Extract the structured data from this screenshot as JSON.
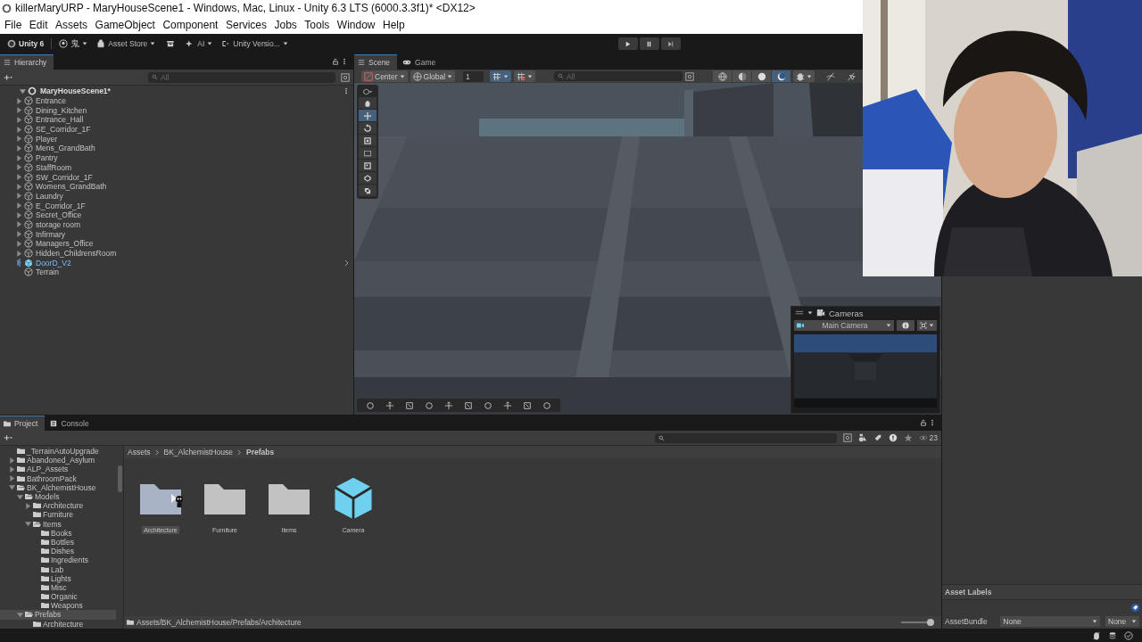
{
  "window": {
    "title": "killerMaryURP - MaryHouseScene1 - Windows, Mac, Linux - Unity 6.3 LTS (6000.3.3f1)* <DX12>"
  },
  "menu": [
    "File",
    "Edit",
    "Assets",
    "GameObject",
    "Component",
    "Services",
    "Jobs",
    "Tools",
    "Window",
    "Help"
  ],
  "toolbar": {
    "account": "Unity 6",
    "user": "鬼",
    "asset_store": "Asset Store",
    "ai": "AI",
    "version_control": "Unity Versio..."
  },
  "hierarchy": {
    "tab": "Hierarchy",
    "search_placeholder": "All",
    "root": {
      "label": "MaryHouseScene1*",
      "expandable": true,
      "expanded": true,
      "children": [
        {
          "label": "Entrance",
          "kind": "object",
          "expandable": true,
          "expanded": false
        },
        {
          "label": "Dining_Kitchen",
          "kind": "object",
          "expandable": true,
          "expanded": false
        },
        {
          "label": "Entrance_Hall",
          "kind": "object",
          "expandable": true,
          "expanded": false
        },
        {
          "label": "SE_Corridor_1F",
          "kind": "object",
          "expandable": true,
          "expanded": false
        },
        {
          "label": "Player",
          "kind": "object",
          "expandable": true,
          "expanded": false
        },
        {
          "label": "Mens_GrandBath",
          "kind": "object",
          "expandable": true,
          "expanded": false
        },
        {
          "label": "Pantry",
          "kind": "object",
          "expandable": true,
          "expanded": false
        },
        {
          "label": "StaffRoom",
          "kind": "object",
          "expandable": true,
          "expanded": false
        },
        {
          "label": "SW_Corridor_1F",
          "kind": "object",
          "expandable": true,
          "expanded": false
        },
        {
          "label": "Womens_GrandBath",
          "kind": "object",
          "expandable": true,
          "expanded": false
        },
        {
          "label": "Laundry",
          "kind": "object",
          "expandable": true,
          "expanded": false
        },
        {
          "label": "E_Corridor_1F",
          "kind": "object",
          "expandable": true,
          "expanded": false
        },
        {
          "label": "Secret_Office",
          "kind": "object",
          "expandable": true,
          "expanded": false
        },
        {
          "label": "storage room",
          "kind": "object",
          "expandable": true,
          "expanded": false
        },
        {
          "label": "Infirmary",
          "kind": "object",
          "expandable": true,
          "expanded": false
        },
        {
          "label": "Managers_Office",
          "kind": "object",
          "expandable": true,
          "expanded": false
        },
        {
          "label": "Hidden_ChildrensRoom",
          "kind": "object",
          "expandable": true,
          "expanded": false
        },
        {
          "label": "DoorD_V2",
          "kind": "prefab",
          "expandable": true,
          "expanded": false
        },
        {
          "label": "Terrain",
          "kind": "object",
          "expandable": false
        }
      ]
    }
  },
  "scene": {
    "tabs": [
      {
        "label": "Scene",
        "selected": true
      },
      {
        "label": "Game",
        "selected": false
      }
    ],
    "pivot": "Center",
    "space": "Global",
    "grid_value": "1",
    "search_placeholder": "All",
    "tools": [
      {
        "kind": "hand",
        "selected": false
      },
      {
        "kind": "move",
        "selected": true
      },
      {
        "kind": "rotate",
        "selected": false
      },
      {
        "kind": "scale",
        "selected": false
      },
      {
        "kind": "rect",
        "selected": false
      },
      {
        "kind": "transform",
        "selected": false
      },
      {
        "kind": "custom",
        "selected": false
      },
      {
        "kind": "shape",
        "selected": false
      }
    ],
    "shading": [
      {
        "kind": "globe",
        "selected": false
      },
      {
        "kind": "half",
        "selected": false
      },
      {
        "kind": "disc",
        "selected": false
      },
      {
        "kind": "ring",
        "selected": true
      }
    ],
    "cameras": {
      "title": "Cameras",
      "camera": "Main Camera"
    }
  },
  "project": {
    "tabs": [
      {
        "label": "Project",
        "selected": true
      },
      {
        "label": "Console",
        "selected": false
      }
    ],
    "tree": [
      {
        "label": "_TerrainAutoUpgrade",
        "expandable": false,
        "selected": false
      },
      {
        "label": "Abandoned_Asylum",
        "expandable": true,
        "expanded": false,
        "selected": false
      },
      {
        "label": "ALP_Assets",
        "expandable": true,
        "expanded": false,
        "selected": false
      },
      {
        "label": "BathroomPack",
        "expandable": true,
        "expanded": false,
        "selected": false
      },
      {
        "label": "BK_AlchemistHouse",
        "expandable": true,
        "expanded": true,
        "selected": false,
        "children": [
          {
            "label": "Models",
            "expandable": true,
            "expanded": true,
            "selected": false,
            "children": [
              {
                "label": "Architecture",
                "expandable": true,
                "expanded": false,
                "selected": false
              },
              {
                "label": "Furniture",
                "expandable": false,
                "selected": false
              },
              {
                "label": "Items",
                "expandable": true,
                "expanded": true,
                "selected": false,
                "children": [
                  {
                    "label": "Books",
                    "expandable": false,
                    "selected": false
                  },
                  {
                    "label": "Bottles",
                    "expandable": false,
                    "selected": false
                  },
                  {
                    "label": "Dishes",
                    "expandable": false,
                    "selected": false
                  },
                  {
                    "label": "Ingredients",
                    "expandable": false,
                    "selected": false
                  },
                  {
                    "label": "Lab",
                    "expandable": false,
                    "selected": false
                  },
                  {
                    "label": "Lights",
                    "expandable": false,
                    "selected": false
                  },
                  {
                    "label": "Misc",
                    "expandable": false,
                    "selected": false
                  },
                  {
                    "label": "Organic",
                    "expandable": false,
                    "selected": false
                  },
                  {
                    "label": "Weapons",
                    "expandable": false,
                    "selected": false
                  }
                ]
              }
            ]
          },
          {
            "label": "Prefabs",
            "expandable": true,
            "expanded": true,
            "selected": true,
            "children": [
              {
                "label": "Architecture",
                "expandable": false,
                "selected": false
              }
            ]
          }
        ]
      }
    ],
    "breadcrumbs": [
      "Assets",
      "BK_AlchemistHouse",
      "Prefabs"
    ],
    "items": [
      {
        "label": "Architecture",
        "kind": "folder",
        "selected": true
      },
      {
        "label": "Furniture",
        "kind": "folder",
        "selected": false
      },
      {
        "label": "Items",
        "kind": "folder",
        "selected": false
      },
      {
        "label": "Camera",
        "kind": "prefab",
        "selected": false
      }
    ],
    "visible_count": "23",
    "path": "Assets/BK_AlchemistHouse/Prefabs/Architecture",
    "zoom": {
      "level": 1
    }
  },
  "inspector": {
    "asset_labels": "Asset Labels",
    "asset_bundle": "AssetBundle",
    "bundle_value": "None",
    "variant_value": "None"
  }
}
